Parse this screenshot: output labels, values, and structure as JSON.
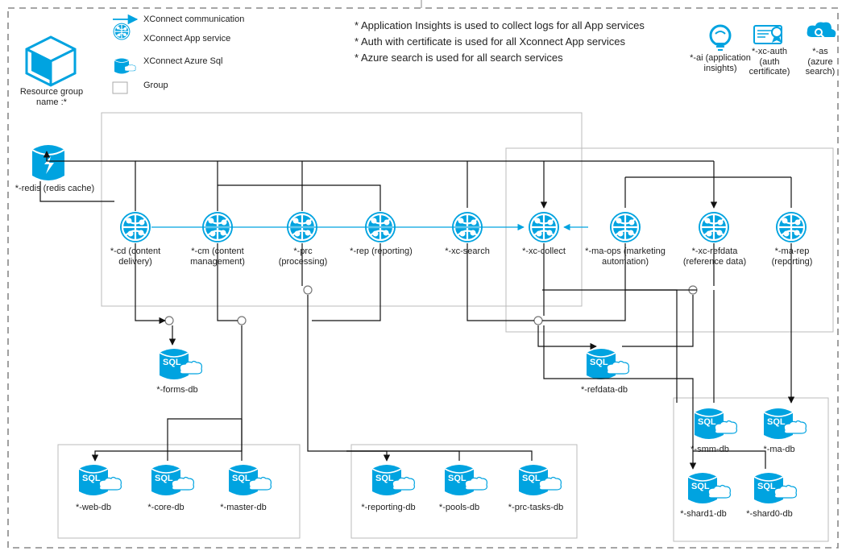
{
  "legend": {
    "communication": "XConnect communication",
    "appservice": "XConnect App service",
    "sql": "XConnect Azure Sql",
    "group": "Group"
  },
  "notes": {
    "n1": "* Application Insights is used to collect logs for all App services",
    "n2": "* Auth with certificate is used for all Xconnect App services",
    "n3": "* Azure search is used for all search services"
  },
  "header": {
    "resourcegroup": "Resource group name :*",
    "ai": "*-ai (application insights)",
    "auth": "*-xc-auth (auth certificate)",
    "as": "*-as (azure search)"
  },
  "items": {
    "redis": "*-redis (redis cache)",
    "cd": "*-cd (content delivery)",
    "cm": "*-cm (content management)",
    "prc": "*-prc (processing)",
    "rep": "*-rep (reporting)",
    "xcsearch": "*-xc-search",
    "xccollect": "*-xc-collect",
    "maops": "*-ma-ops (marketing automation)",
    "xcrefdata": "*-xc-refdata (reference data)",
    "marep": "*-ma-rep (reporting)"
  },
  "dbs": {
    "forms": "*-forms-db",
    "refdata": "*-refdata-db",
    "web": "*-web-db",
    "core": "*-core-db",
    "master": "*-master-db",
    "reporting": "*-reporting-db",
    "pools": "*-pools-db",
    "prctasks": "*-prc-tasks-db",
    "smm": "*-smm-db",
    "ma": "*-ma-db",
    "shard1": "*-shard1-db",
    "shard0": "*-shard0-db"
  },
  "sql_label": "SQL"
}
